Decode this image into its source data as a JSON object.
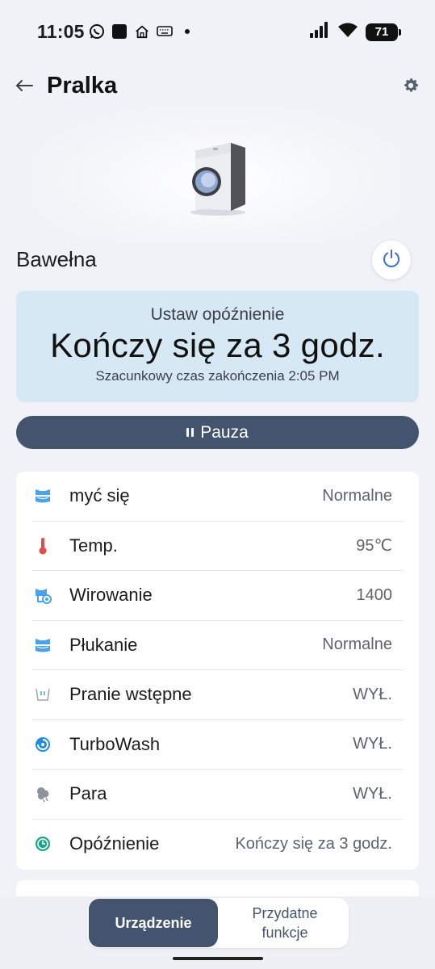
{
  "status_bar": {
    "time": "11:05",
    "battery": "71",
    "left_icons": [
      "whatsapp-icon",
      "app-square-icon",
      "home-icon",
      "keyboard-icon",
      "dot-icon"
    ],
    "right_icons": [
      "signal-icon",
      "wifi-icon",
      "battery-icon"
    ]
  },
  "header": {
    "title": "Pralka",
    "back_icon": "arrow-left-icon",
    "settings_icon": "gear-icon"
  },
  "device": {
    "image": "washing-machine",
    "program": "Bawełna"
  },
  "status": {
    "label": "Ustaw opóźnienie",
    "main": "Kończy się za 3 godz.",
    "sub": "Szacunkowy czas zakończenia 2:05 PM"
  },
  "pause_button": {
    "label": "Pauza",
    "icon": "pause-icon"
  },
  "settings": [
    {
      "icon": "wash-icon",
      "label": "myć się",
      "value": "Normalne"
    },
    {
      "icon": "thermometer-icon",
      "label": "Temp.",
      "value": "95℃"
    },
    {
      "icon": "spin-icon",
      "label": "Wirowanie",
      "value": "1400"
    },
    {
      "icon": "rinse-icon",
      "label": "Płukanie",
      "value": "Normalne"
    },
    {
      "icon": "prewash-icon",
      "label": "Pranie wstępne",
      "value": "WYŁ."
    },
    {
      "icon": "turbowash-icon",
      "label": "TurboWash",
      "value": "WYŁ."
    },
    {
      "icon": "steam-icon",
      "label": "Para",
      "value": "WYŁ."
    },
    {
      "icon": "delay-clock-icon",
      "label": "Opóźnienie",
      "value": "Kończy się za 3 godz."
    }
  ],
  "bottom_nav": {
    "active": "Urządzenie",
    "other_line1": "Przydatne",
    "other_line2": "funkcje"
  },
  "colors": {
    "accent": "#44546e",
    "status_card": "#d7e8f5",
    "background": "#f0f2f7",
    "power_blue": "#3b6fd8"
  }
}
